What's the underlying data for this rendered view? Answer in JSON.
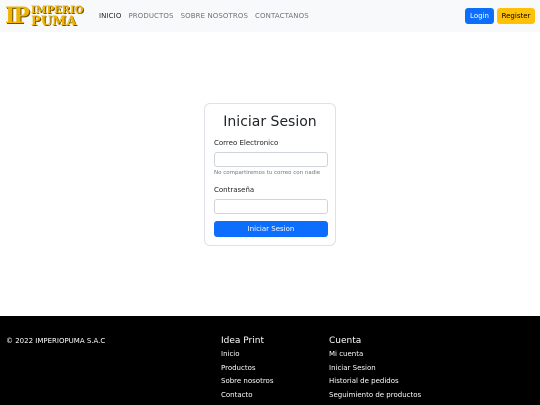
{
  "brand": {
    "logo_mark": "IP",
    "logo_top": "IMPERIO",
    "logo_bottom": "PUMA",
    "logo_color": "#f0b400"
  },
  "nav": {
    "items": [
      {
        "label": "INICIO",
        "active": true
      },
      {
        "label": "PRODUCTOS",
        "active": false
      },
      {
        "label": "SOBRE NOSOTROS",
        "active": false
      },
      {
        "label": "CONTACTANOS",
        "active": false
      }
    ],
    "login_label": "Login",
    "register_label": "Register",
    "login_color": "#0d6efd",
    "register_color": "#ffc107"
  },
  "login_form": {
    "title": "Iniciar Sesion",
    "email_label": "Correo Electronico",
    "email_value": "",
    "email_help": "No compartiremos tu correo con nadie",
    "password_label": "Contraseña",
    "password_value": "",
    "submit_label": "Iniciar Sesion"
  },
  "footer": {
    "copyright": "© 2022 IMPERIOPUMA S.A.C",
    "col1": {
      "title": "Idea Print",
      "links": [
        "Inicio",
        "Productos",
        "Sobre nosotros",
        "Contacto"
      ]
    },
    "col2": {
      "title": "Cuenta",
      "links": [
        "Mi cuenta",
        "Iniciar Sesion",
        "Historial de pedidos",
        "Seguimiento de productos"
      ]
    },
    "background": "#000000"
  }
}
